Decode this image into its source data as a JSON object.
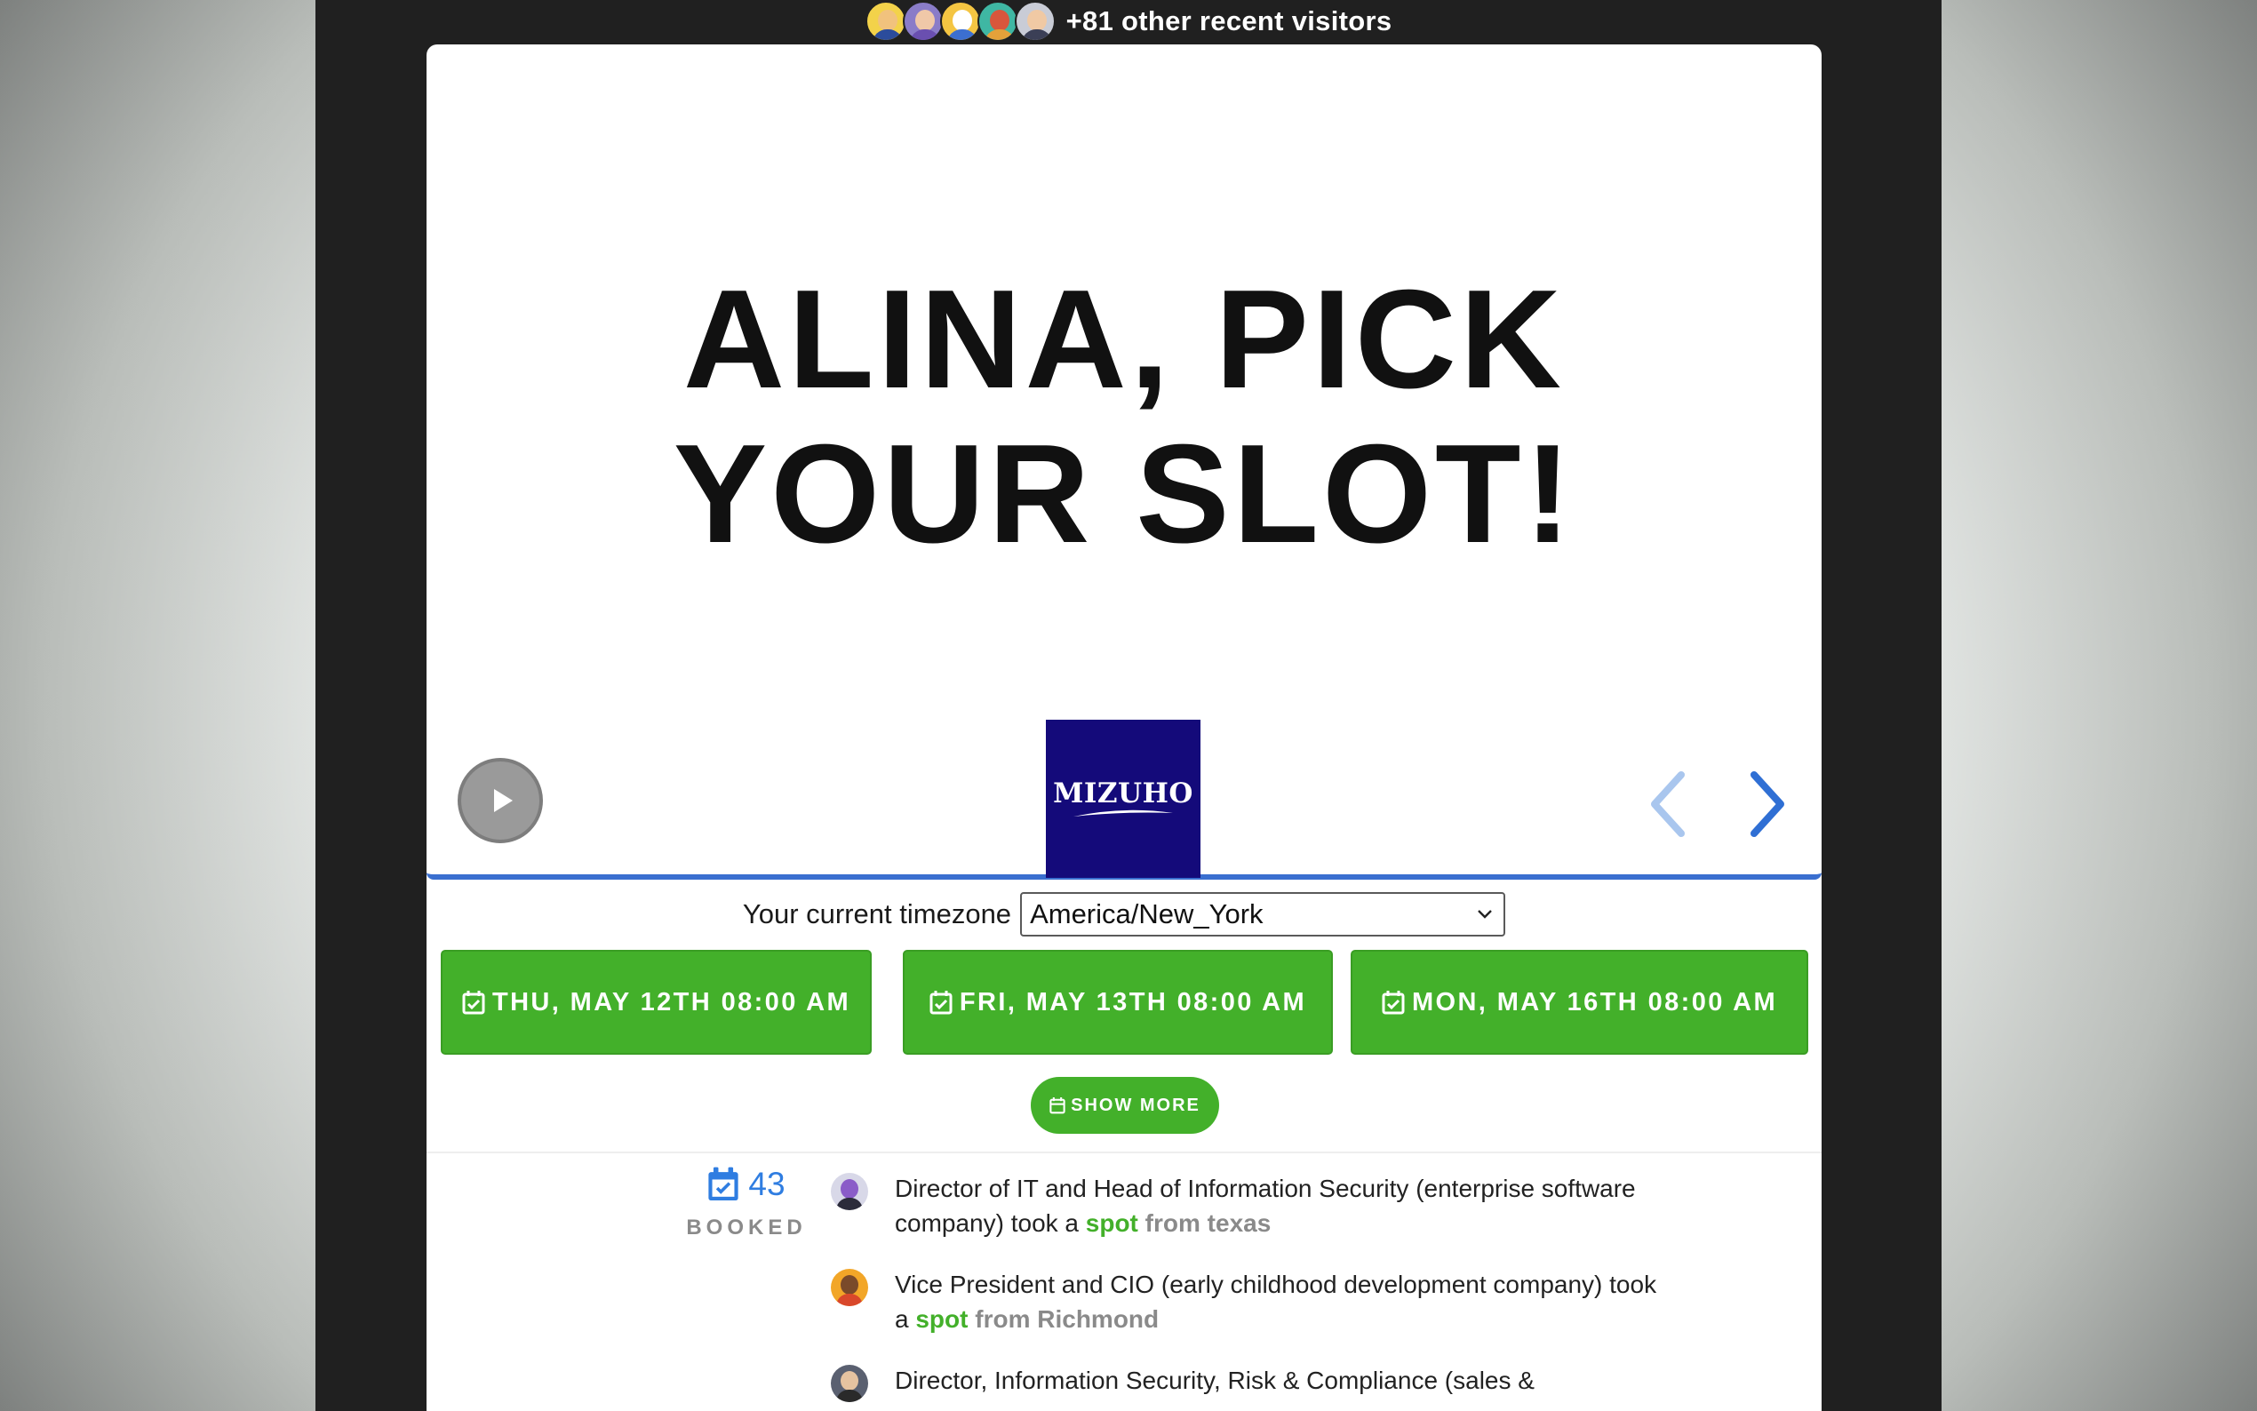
{
  "visitors": {
    "avatar_icons": [
      "avatar-sunglasses-man",
      "avatar-purple-hair-woman",
      "avatar-clown",
      "avatar-red-hair-person",
      "avatar-dark-hair-man"
    ],
    "text": "+81 other recent visitors"
  },
  "hero": {
    "title_line1": "ALINA, PICK",
    "title_line2": "YOUR SLOT!",
    "logo_text": "MIZUHO",
    "play_icon": "play-icon",
    "prev_icon": "chevron-left-icon",
    "next_icon": "chevron-right-icon"
  },
  "timezone": {
    "label": "Your current timezone",
    "value": "America/New_York"
  },
  "slots": [
    {
      "label": "THU, MAY 12TH 08:00 AM"
    },
    {
      "label": "FRI, MAY 13TH 08:00 AM"
    },
    {
      "label": "MON, MAY 16TH 08:00 AM"
    }
  ],
  "show_more": {
    "label": "SHOW MORE"
  },
  "booked": {
    "count": "43",
    "label": "BOOKED"
  },
  "activity": [
    {
      "text": "Director of IT and Head of Information Security (enterprise software company) took a ",
      "spot": "spot",
      "from": " from texas"
    },
    {
      "text": "Vice President and CIO (early childhood development company) took a ",
      "spot": "spot",
      "from": " from Richmond"
    },
    {
      "text": "Director, Information Security, Risk & Compliance (sales &",
      "spot": "",
      "from": ""
    }
  ],
  "colors": {
    "green": "#43b02a",
    "blue_accent": "#3a6fd0",
    "booked_blue": "#2f7de1",
    "logo_navy": "#140a7a"
  }
}
